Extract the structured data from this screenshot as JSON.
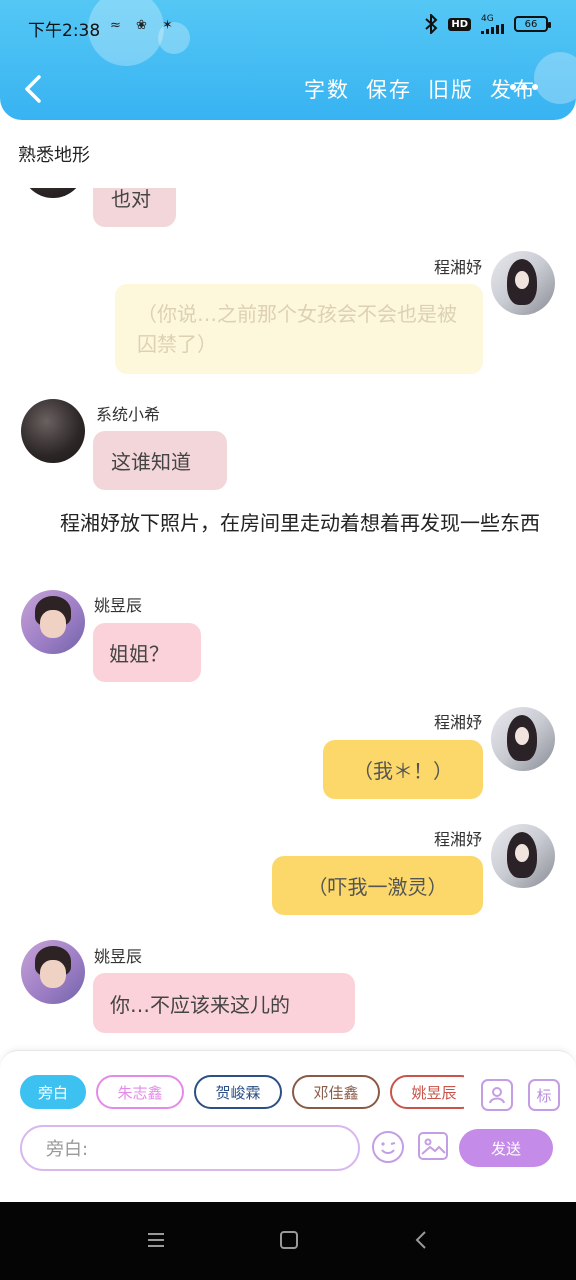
{
  "status": {
    "time": "下午2:38",
    "mini_icons": [
      "≈",
      "❀",
      "✶"
    ],
    "network": "4G",
    "hd_label": "HD",
    "battery": "66"
  },
  "nav": {
    "actions": [
      "字数",
      "保存",
      "旧版",
      "发布"
    ]
  },
  "page": {
    "title": "熟悉地形"
  },
  "messages": {
    "m0": {
      "text": "也对"
    },
    "m1": {
      "sender": "程湘妤",
      "text": "（你说…之前那个女孩会不会也是被囚禁了）"
    },
    "m2": {
      "sender": "系统小希",
      "text": "这谁知道"
    },
    "narration": "程湘妤放下照片，在房间里走动着想着再发现一些东西",
    "m3": {
      "sender": "姚昱辰",
      "text": "姐姐？"
    },
    "m4": {
      "sender": "程湘妤",
      "text": "（我＊！）"
    },
    "m5": {
      "sender": "程湘妤",
      "text": "（吓我一激灵）"
    },
    "m6": {
      "sender": "姚昱辰",
      "text": "你…不应该来这儿的"
    }
  },
  "composer": {
    "tabs": [
      "旁白",
      "朱志鑫",
      "贺峻霖",
      "邓佳鑫",
      "姚昱辰"
    ],
    "tab_colors": [
      "#3cc1f0",
      "#e38be8",
      "#2b4f86",
      "#8a5a45",
      "#c9544a"
    ],
    "placeholder": "旁白:",
    "send_label": "发送",
    "tag_icon_label": "标"
  }
}
